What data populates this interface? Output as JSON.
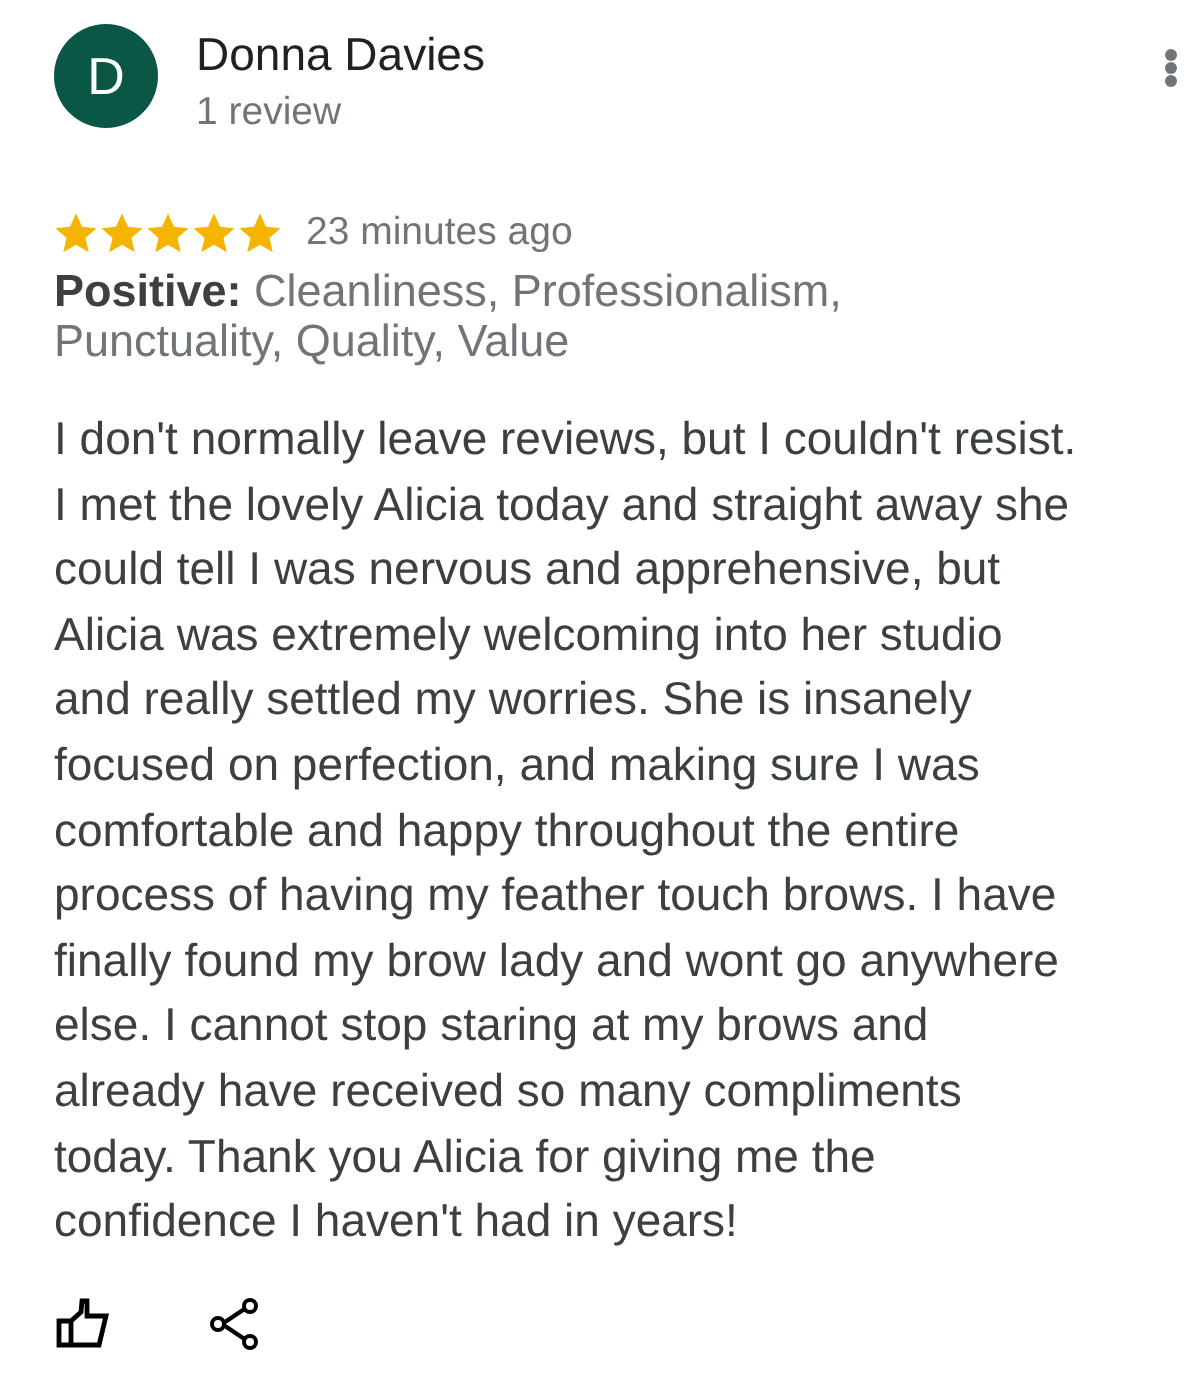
{
  "reviewer": {
    "initial": "D",
    "name": "Donna Davies",
    "review_count": "1 review"
  },
  "review": {
    "stars": 5,
    "time": "23 minutes ago",
    "positive": "**Positive:** Cleanliness, Professionalism, Punctuality, Quality, Value",
    "body": "I don't normally leave reviews, but I couldn't resist. I met the lovely Alicia today and straight away she could tell I was nervous and apprehensive, but Alicia was extremely welcoming into her studio and really settled my worries. She is insanely focused on perfection, and making sure I was comfortable and happy throughout the entire process of having my feather touch brows. I have finally found my brow lady and wont go anywhere else. I cannot stop staring at my brows and already have received so many compliments today. Thank you Alicia for giving me the confidence I haven't had in years!"
  }
}
